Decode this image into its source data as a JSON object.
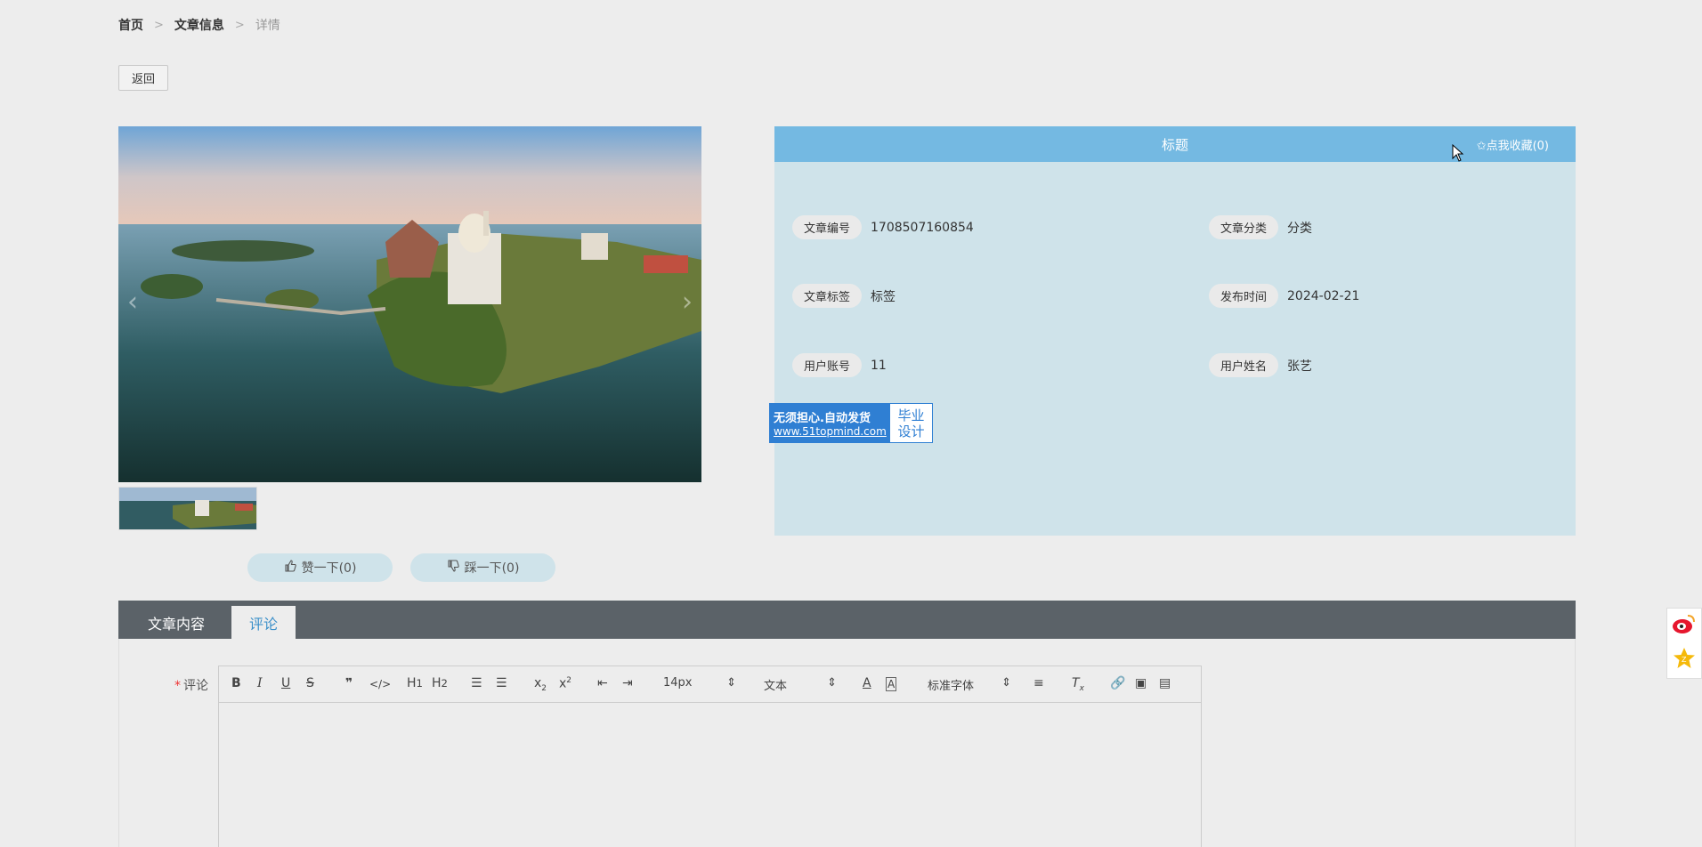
{
  "breadcrumb": {
    "items": [
      "首页",
      "文章信息",
      "详情"
    ],
    "separator": ">"
  },
  "back_button": "返回",
  "gallery": {
    "prev_arrow": "‹",
    "next_arrow": "›"
  },
  "info": {
    "title": "标题",
    "favorite": "✩点我收藏(0)",
    "fields": [
      {
        "label": "文章编号",
        "value": "1708507160854"
      },
      {
        "label": "文章分类",
        "value": "分类"
      },
      {
        "label": "文章标签",
        "value": "标签"
      },
      {
        "label": "发布时间",
        "value": "2024-02-21"
      },
      {
        "label": "用户账号",
        "value": "11"
      },
      {
        "label": "用户姓名",
        "value": "张艺"
      }
    ]
  },
  "watermark": {
    "line1": "无须担心.自动发货",
    "line2": "www.51topmind.com",
    "right1": "毕业",
    "right2": "设计"
  },
  "votes": {
    "up": "赞一下(0)",
    "down": "踩一下(0)"
  },
  "tabs": {
    "content": "文章内容",
    "comment": "评论"
  },
  "comment": {
    "label": "评论",
    "required_mark": "*",
    "font_size": "14px",
    "text_type": "文本",
    "font_family": "标准字体"
  },
  "colors": {
    "header_blue": "#74b9e2",
    "panel_bg": "#cfe3ea",
    "tab_bar": "#5b6268"
  }
}
